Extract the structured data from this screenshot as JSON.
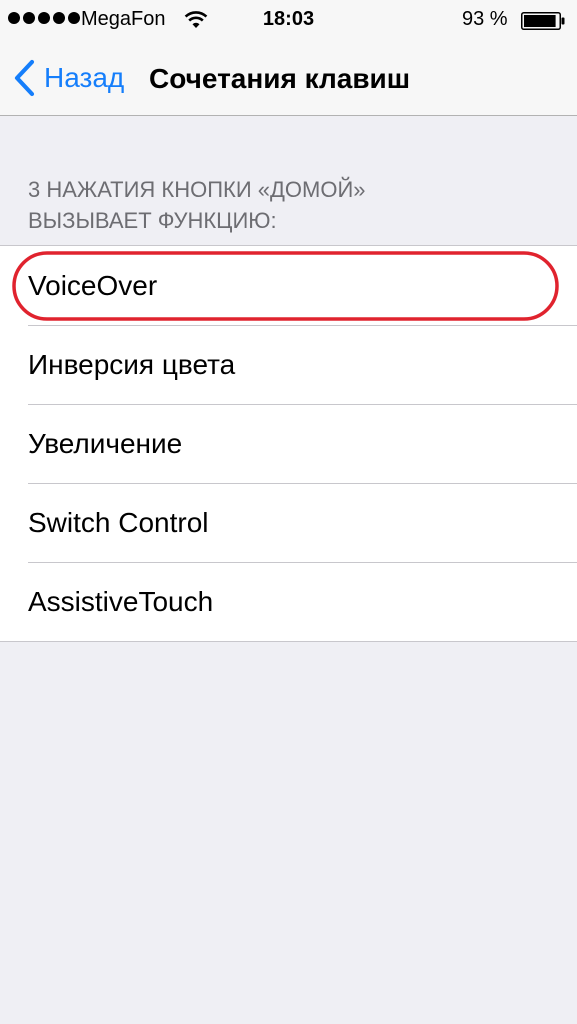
{
  "status_bar": {
    "carrier": "MegaFon",
    "time": "18:03",
    "battery_percent": "93 %",
    "battery_level": 0.93,
    "signal_bars": 5
  },
  "nav": {
    "back_label": "Назад",
    "title": "Сочетания клавиш"
  },
  "section": {
    "header_line1": "3 НАЖАТИЯ КНОПКИ «ДОМОЙ»",
    "header_line2": "ВЫЗЫВАЕТ ФУНКЦИЮ:"
  },
  "items": [
    {
      "label": "VoiceOver",
      "highlighted": true
    },
    {
      "label": "Инверсия цвета"
    },
    {
      "label": "Увеличение"
    },
    {
      "label": "Switch Control"
    },
    {
      "label": "AssistiveTouch"
    }
  ],
  "colors": {
    "accent": "#157efb",
    "background": "#efeff4",
    "highlight_oval": "#e0232e"
  }
}
